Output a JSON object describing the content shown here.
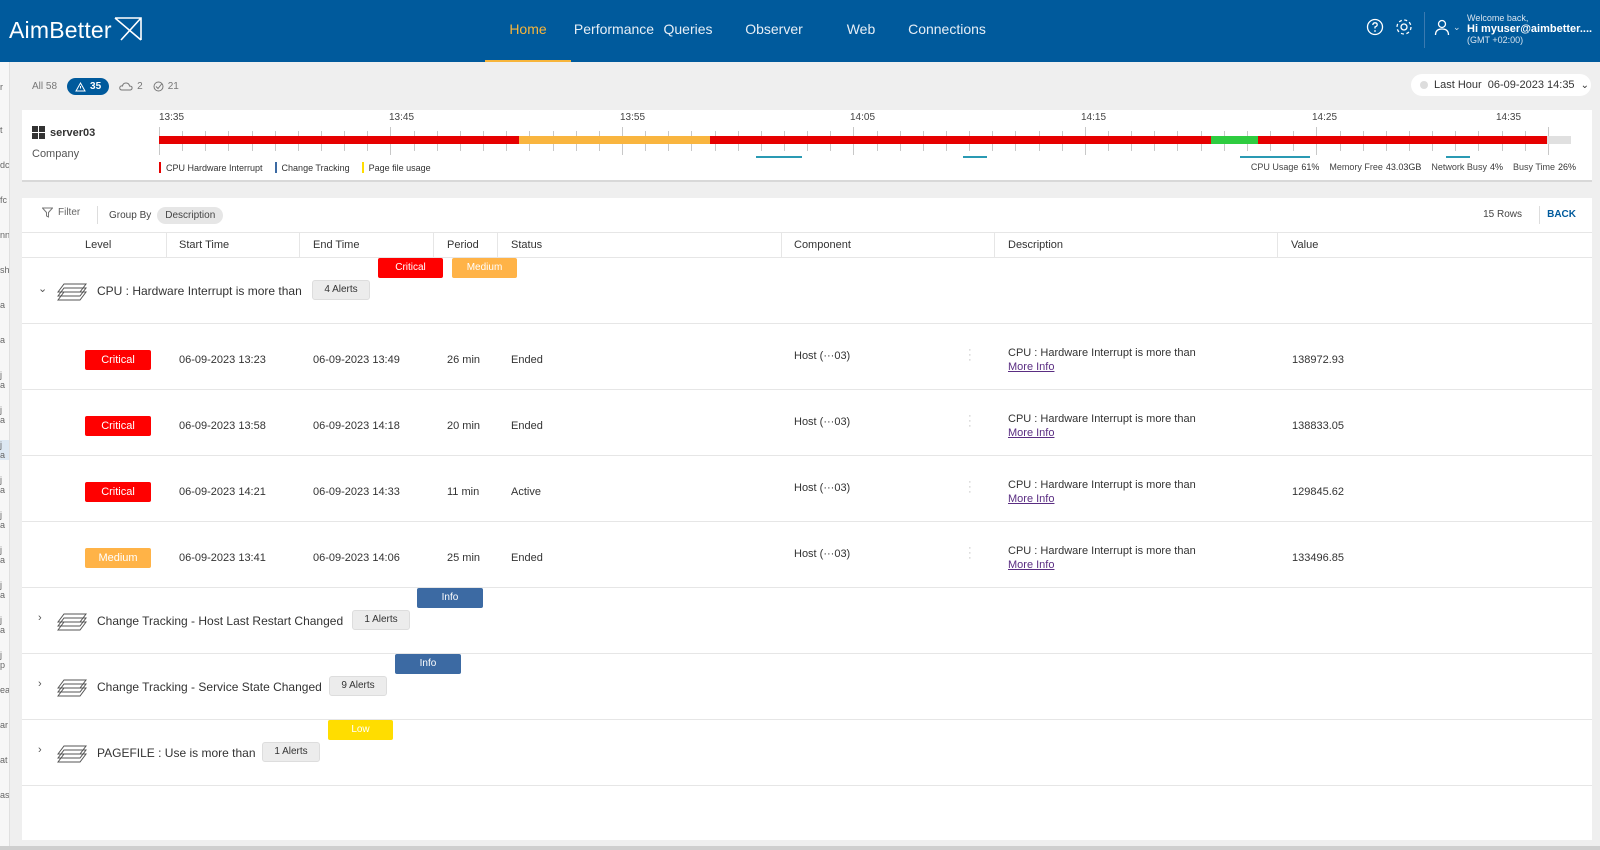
{
  "brand": {
    "name": "AimBetter"
  },
  "nav": [
    "Home",
    "Performance",
    "Queries",
    "Observer",
    "Web",
    "Connections"
  ],
  "user": {
    "welcome": "Welcome back,",
    "name": "Hi myuser@aimbetter....",
    "tz": "(GMT +02:00)"
  },
  "left_strip": [
    "r",
    "t",
    "dc",
    "fc",
    "nn",
    "sh",
    "a",
    "a",
    "j a",
    "j a",
    "j a",
    "j a",
    "j a",
    "j a",
    "j a",
    "j a",
    "j p",
    "ea",
    "ar",
    "at",
    "as"
  ],
  "chips": {
    "all": "All 58",
    "alerts": "35",
    "cloud": "2",
    "done": "21"
  },
  "timeframe": {
    "label": "Last Hour",
    "value": "06-09-2023 14:35"
  },
  "server": {
    "name": "server03",
    "company": "Company"
  },
  "timeline": {
    "ticks": [
      "13:35",
      "13:45",
      "13:55",
      "14:05",
      "14:15",
      "14:25",
      "14:35"
    ],
    "segments": [
      {
        "from": 0.0,
        "to": 0.255,
        "color": "#e60000"
      },
      {
        "from": 0.255,
        "to": 0.39,
        "color": "#f9b53f"
      },
      {
        "from": 0.39,
        "to": 0.745,
        "color": "#e60000"
      },
      {
        "from": 0.745,
        "to": 0.778,
        "color": "#2ecc40"
      },
      {
        "from": 0.778,
        "to": 0.983,
        "color": "#e60000"
      },
      {
        "from": 0.983,
        "to": 1.0,
        "color": "#e0e0e0"
      }
    ],
    "legend": [
      {
        "label": "CPU Hardware Interrupt",
        "color": "#e60000"
      },
      {
        "label": "Change Tracking",
        "color": "#3c6aa3"
      },
      {
        "label": "Page file usage",
        "color": "#ffdd00"
      }
    ],
    "stats": [
      {
        "label": "CPU Usage",
        "value": "61%"
      },
      {
        "label": "Memory Free",
        "value": "43.03GB"
      },
      {
        "label": "Network Busy",
        "value": "4%"
      },
      {
        "label": "Busy Time",
        "value": "26%"
      }
    ]
  },
  "toolbar": {
    "filter": "Filter",
    "group_by": "Group By",
    "group_value": "Description",
    "rows": "15 Rows",
    "back": "BACK"
  },
  "columns": [
    "Level",
    "Start Time",
    "End Time",
    "Period",
    "Status",
    "Component",
    "Description",
    "Value"
  ],
  "groups": [
    {
      "title": "CPU : Hardware Interrupt is more than",
      "count": "4 Alerts",
      "badges": [
        "Critical",
        "Medium"
      ],
      "chevron": "⌄"
    },
    {
      "title": "Change Tracking - Host Last Restart Changed",
      "count": "1 Alerts",
      "badges": [
        "Info"
      ],
      "chevron": "›"
    },
    {
      "title": "Change Tracking - Service State Changed",
      "count": "9 Alerts",
      "badges": [
        "Info"
      ],
      "chevron": "›"
    },
    {
      "title": "PAGEFILE : Use is more than",
      "count": "1 Alerts",
      "badges": [
        "Low"
      ],
      "chevron": "›"
    }
  ],
  "rows": [
    {
      "level": "Critical",
      "start": "06-09-2023 13:23",
      "end": "06-09-2023 13:49",
      "period": "26 min",
      "status": "Ended",
      "component": "Host (···03)",
      "desc": "CPU : Hardware Interrupt is more than",
      "more": "More Info",
      "value": "138972.93"
    },
    {
      "level": "Critical",
      "start": "06-09-2023 13:58",
      "end": "06-09-2023 14:18",
      "period": "20 min",
      "status": "Ended",
      "component": "Host (···03)",
      "desc": "CPU : Hardware Interrupt is more than",
      "more": "More Info",
      "value": "138833.05"
    },
    {
      "level": "Critical",
      "start": "06-09-2023 14:21",
      "end": "06-09-2023 14:33",
      "period": "11 min",
      "status": "Active",
      "component": "Host (···03)",
      "desc": "CPU : Hardware Interrupt is more than",
      "more": "More Info",
      "value": "129845.62"
    },
    {
      "level": "Medium",
      "start": "06-09-2023 13:41",
      "end": "06-09-2023 14:06",
      "period": "25 min",
      "status": "Ended",
      "component": "Host (···03)",
      "desc": "CPU : Hardware Interrupt is more than",
      "more": "More Info",
      "value": "133496.85"
    }
  ]
}
